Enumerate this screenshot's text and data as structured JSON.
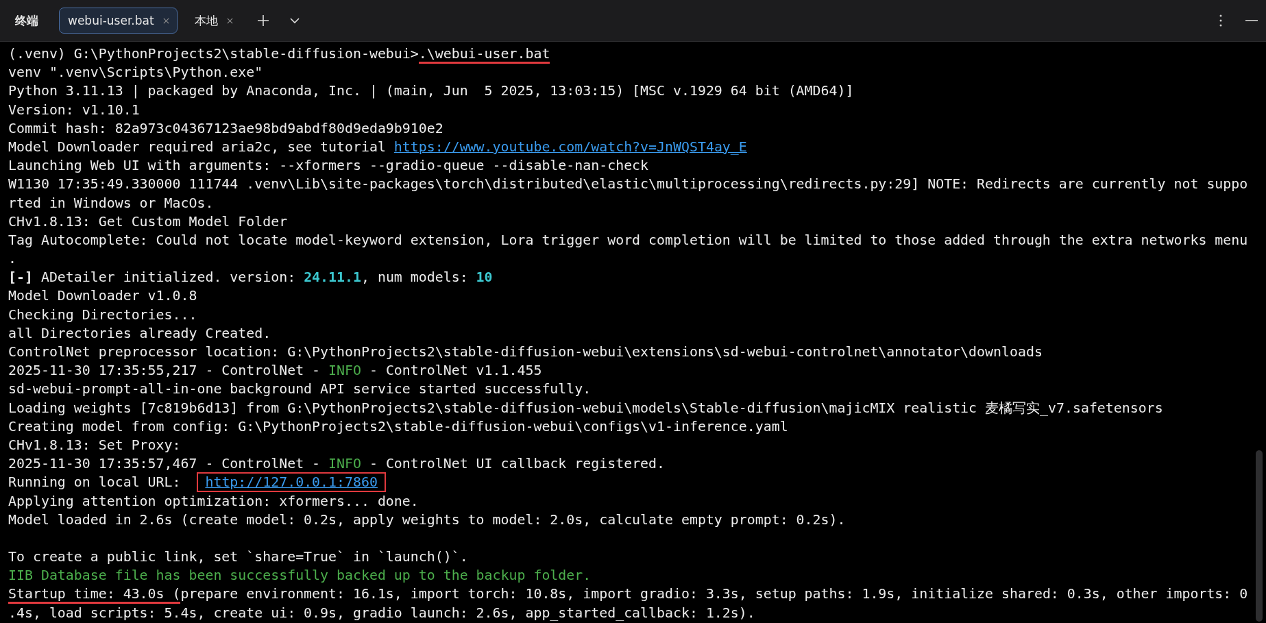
{
  "window": {
    "title": "终端"
  },
  "tabs": [
    {
      "label": "webui-user.bat",
      "selected": true
    },
    {
      "label": "本地",
      "selected": false
    }
  ],
  "lines": [
    {
      "kind": "text",
      "segments": [
        {
          "text": "(.venv) G:\\PythonProjects2\\stable-diffusion-webui>",
          "kind": "plain"
        },
        {
          "text": ".\\webui-user.bat",
          "kind": "underlined"
        }
      ]
    },
    {
      "kind": "text",
      "segments": [
        {
          "text": "venv \".venv\\Scripts\\Python.exe\"",
          "kind": "plain"
        }
      ]
    },
    {
      "kind": "text",
      "segments": [
        {
          "text": "Python 3.11.13 | packaged by Anaconda, Inc. | (main, Jun  5 2025, 13:03:15) [MSC v.1929 64 bit (AMD64)]",
          "kind": "plain"
        }
      ]
    },
    {
      "kind": "text",
      "segments": [
        {
          "text": "Version: v1.10.1",
          "kind": "plain"
        }
      ]
    },
    {
      "kind": "text",
      "segments": [
        {
          "text": "Commit hash: 82a973c04367123ae98bd9abdf80d9eda9b910e2",
          "kind": "plain"
        }
      ]
    },
    {
      "kind": "text",
      "segments": [
        {
          "text": "Model Downloader required aria2c, see tutorial ",
          "kind": "plain"
        },
        {
          "text": "https://www.youtube.com/watch?v=JnWQST4ay_E",
          "kind": "link"
        }
      ]
    },
    {
      "kind": "text",
      "segments": [
        {
          "text": "Launching Web UI with arguments: --xformers --gradio-queue --disable-nan-check",
          "kind": "plain"
        }
      ]
    },
    {
      "kind": "text",
      "segments": [
        {
          "text": "W1130 17:35:49.330000 111744 .venv\\Lib\\site-packages\\torch\\distributed\\elastic\\multiprocessing\\redirects.py:29] NOTE: Redirects are currently not suppo",
          "kind": "plain"
        }
      ]
    },
    {
      "kind": "text",
      "segments": [
        {
          "text": "rted in Windows or MacOs.",
          "kind": "plain"
        }
      ]
    },
    {
      "kind": "text",
      "segments": [
        {
          "text": "CHv1.8.13: Get Custom Model Folder",
          "kind": "plain"
        }
      ]
    },
    {
      "kind": "text",
      "segments": [
        {
          "text": "Tag Autocomplete: Could not locate model-keyword extension, Lora trigger word completion will be limited to those added through the extra networks menu",
          "kind": "plain"
        }
      ]
    },
    {
      "kind": "text",
      "segments": [
        {
          "text": ".",
          "kind": "plain"
        }
      ]
    },
    {
      "kind": "text",
      "segments": [
        {
          "text": "[-]",
          "kind": "bold"
        },
        {
          "text": " ADetailer initialized. version: ",
          "kind": "plain"
        },
        {
          "text": "24.11.1",
          "kind": "cyan"
        },
        {
          "text": ", num models: ",
          "kind": "plain"
        },
        {
          "text": "10",
          "kind": "cyan"
        }
      ]
    },
    {
      "kind": "text",
      "segments": [
        {
          "text": "Model Downloader v1.0.8",
          "kind": "plain"
        }
      ]
    },
    {
      "kind": "text",
      "segments": [
        {
          "text": "Checking Directories...",
          "kind": "plain"
        }
      ]
    },
    {
      "kind": "text",
      "segments": [
        {
          "text": "all Directories already Created.",
          "kind": "plain"
        }
      ]
    },
    {
      "kind": "text",
      "segments": [
        {
          "text": "ControlNet preprocessor location: G:\\PythonProjects2\\stable-diffusion-webui\\extensions\\sd-webui-controlnet\\annotator\\downloads",
          "kind": "plain"
        }
      ]
    },
    {
      "kind": "text",
      "segments": [
        {
          "text": "2025-11-30 17:35:55,217 - ControlNet - ",
          "kind": "plain"
        },
        {
          "text": "INFO",
          "kind": "green"
        },
        {
          "text": " - ControlNet v1.1.455",
          "kind": "plain"
        }
      ]
    },
    {
      "kind": "text",
      "segments": [
        {
          "text": "sd-webui-prompt-all-in-one background API service started successfully.",
          "kind": "plain"
        }
      ]
    },
    {
      "kind": "text",
      "segments": [
        {
          "text": "Loading weights [7c819b6d13] from G:\\PythonProjects2\\stable-diffusion-webui\\models\\Stable-diffusion\\majicMIX realistic 麦橘写实_v7.safetensors",
          "kind": "plain"
        }
      ]
    },
    {
      "kind": "text",
      "segments": [
        {
          "text": "Creating model from config: G:\\PythonProjects2\\stable-diffusion-webui\\configs\\v1-inference.yaml",
          "kind": "plain"
        }
      ]
    },
    {
      "kind": "text",
      "segments": [
        {
          "text": "CHv1.8.13: Set Proxy:",
          "kind": "plain"
        }
      ]
    },
    {
      "kind": "text",
      "segments": [
        {
          "text": "2025-11-30 17:35:57,467 - ControlNet - ",
          "kind": "plain"
        },
        {
          "text": "INFO",
          "kind": "green"
        },
        {
          "text": " - ControlNet UI callback registered.",
          "kind": "plain"
        }
      ]
    },
    {
      "kind": "text",
      "segments": [
        {
          "text": "Running on local URL:  ",
          "kind": "plain"
        },
        {
          "text": "http://127.0.0.1:7860",
          "kind": "boxed-link"
        }
      ]
    },
    {
      "kind": "text",
      "segments": [
        {
          "text": "Applying attention optimization: xformers... done.",
          "kind": "plain"
        }
      ]
    },
    {
      "kind": "text",
      "segments": [
        {
          "text": "Model loaded in 2.6s (create model: 0.2s, apply weights to model: 2.0s, calculate empty prompt: 0.2s).",
          "kind": "plain"
        }
      ]
    },
    {
      "kind": "blank"
    },
    {
      "kind": "text",
      "segments": [
        {
          "text": "To create a public link, set `share=True` in `launch()`.",
          "kind": "plain"
        }
      ]
    },
    {
      "kind": "text",
      "segments": [
        {
          "text": "IIB Database file has been successfully backed up to the backup folder.",
          "kind": "green"
        }
      ]
    },
    {
      "kind": "text",
      "segments": [
        {
          "text": "Startup time: 43.0s (",
          "kind": "underlined"
        },
        {
          "text": "prepare environment: 16.1s, import torch: 10.8s, import gradio: 3.3s, setup paths: 1.9s, initialize shared: 0.3s, other imports: 0",
          "kind": "plain"
        }
      ]
    },
    {
      "kind": "text",
      "segments": [
        {
          "text": ".4s, load scripts: 5.4s, create ui: 0.9s, gradio launch: 2.6s, app_started_callback: 1.2s).",
          "kind": "plain"
        }
      ]
    }
  ]
}
